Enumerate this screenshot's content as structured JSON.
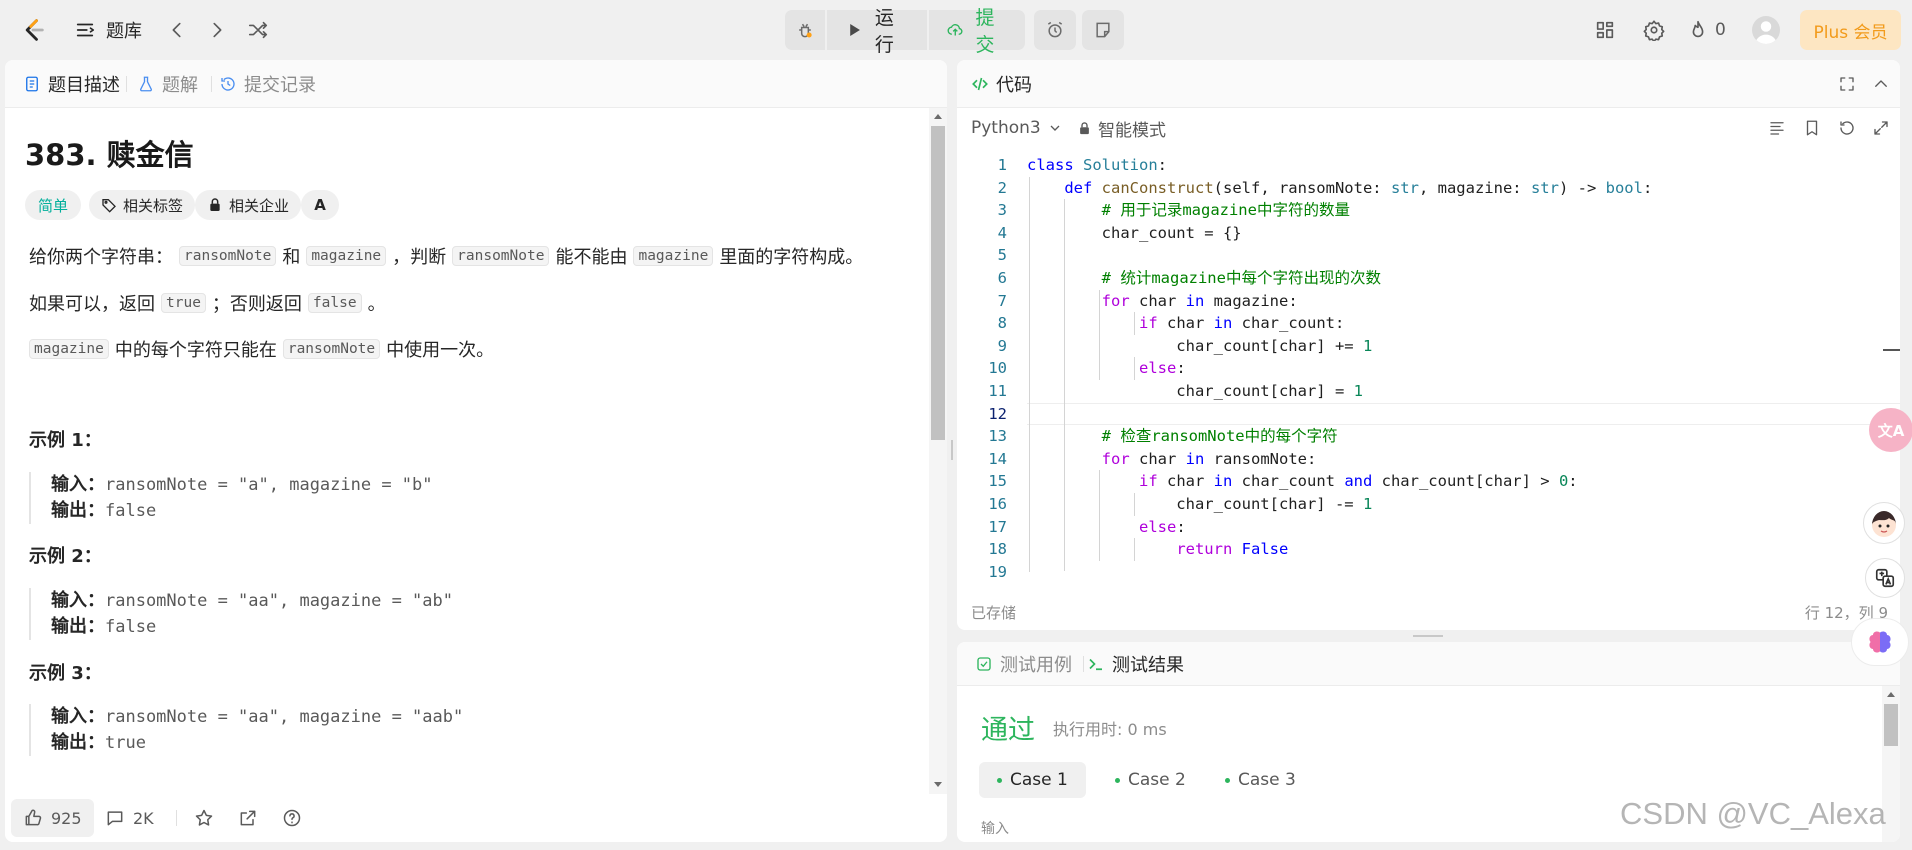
{
  "topbar": {
    "problem_list_label": "题库",
    "run_label": "运行",
    "submit_label": "提交",
    "fire_count": "0",
    "plus_label": "Plus 会员"
  },
  "left_panel": {
    "tabs": [
      "题目描述",
      "题解",
      "提交记录"
    ],
    "title": "383. 赎金信",
    "tags": {
      "difficulty": "简单",
      "topics": "相关标签",
      "companies": "相关企业",
      "translate": "A"
    },
    "desc1": {
      "pre": "给你两个字符串：",
      "c1": "ransomNote",
      "mid1": "和",
      "c2": "magazine",
      "mid2": "，判断",
      "c3": "ransomNote",
      "mid3": "能不能由",
      "c4": "magazine",
      "post": "里面的字符构成。"
    },
    "desc2": {
      "pre": "如果可以，返回",
      "c1": "true",
      "mid": "；否则返回",
      "c2": "false",
      "post": "。"
    },
    "desc3": {
      "c1": "magazine",
      "mid": "中的每个字符只能在",
      "c2": "ransomNote",
      "post": "中使用一次。"
    },
    "examples": [
      {
        "title": "示例 1：",
        "input_label": "输入：",
        "input": "ransomNote = \"a\", magazine = \"b\"",
        "output_label": "输出：",
        "output": "false"
      },
      {
        "title": "示例 2：",
        "input_label": "输入：",
        "input": "ransomNote = \"aa\", magazine = \"ab\"",
        "output_label": "输出：",
        "output": "false"
      },
      {
        "title": "示例 3：",
        "input_label": "输入：",
        "input": "ransomNote = \"aa\", magazine = \"aab\"",
        "output_label": "输出：",
        "output": "true"
      }
    ],
    "footer": {
      "likes": "925",
      "comments": "2K"
    }
  },
  "code_panel": {
    "tab_label": "代码",
    "language": "Python3",
    "mode": "智能模式",
    "saved": "已存储",
    "cursor": "行 12，列 9",
    "lines": [
      "class Solution:",
      "    def canConstruct(self, ransomNote: str, magazine: str) -> bool:",
      "        # 用于记录magazine中字符的数量",
      "        char_count = {}",
      "",
      "        # 统计magazine中每个字符出现的次数",
      "        for char in magazine:",
      "            if char in char_count:",
      "                char_count[char] += 1",
      "            else:",
      "                char_count[char] = 1",
      "",
      "        # 检查ransomNote中的每个字符",
      "        for char in ransomNote:",
      "            if char in char_count and char_count[char] > 0:",
      "                char_count[char] -= 1",
      "            else:",
      "                return False",
      ""
    ]
  },
  "result_panel": {
    "tabs": [
      "测试用例",
      "测试结果"
    ],
    "status": "通过",
    "runtime": "执行用时: 0 ms",
    "cases": [
      "Case 1",
      "Case 2",
      "Case 3"
    ],
    "input_label": "输入"
  },
  "watermark": "CSDN @VC_Alexa",
  "colors": {
    "accent_green": "#2db55d",
    "brand_orange": "#ffa116",
    "easy_teal": "#00af9b"
  }
}
